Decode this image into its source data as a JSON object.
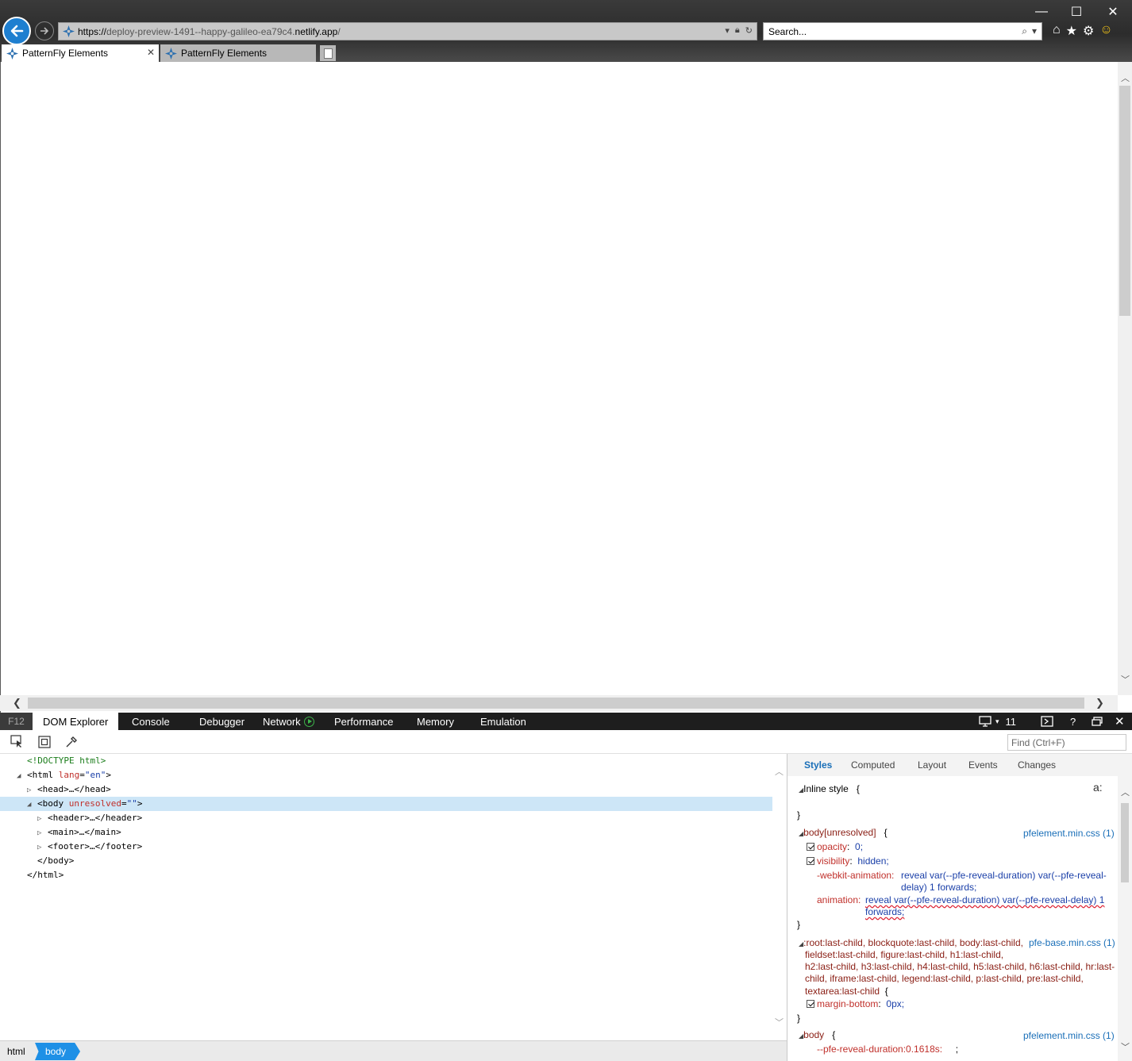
{
  "window": {
    "minimize": "—",
    "maximize": "☐",
    "close": "✕"
  },
  "address_bar": {
    "scheme": "https://",
    "host_prefix": "deploy-preview-1491--happy-galileo-ea79c4.",
    "host_domain": "netlify.app",
    "path": "/"
  },
  "search_bar": {
    "placeholder": "Search..."
  },
  "tabs": [
    {
      "label": "PatternFly Elements",
      "active": true
    },
    {
      "label": "PatternFly Elements",
      "active": false
    }
  ],
  "devtools": {
    "f12_label": "F12",
    "tabs": [
      "DOM Explorer",
      "Console",
      "Debugger",
      "Network",
      "Performance",
      "Memory",
      "Emulation"
    ],
    "doc_mode": "11",
    "help": "?",
    "find_placeholder": "Find (Ctrl+F)"
  },
  "dom_tree": {
    "doctype": "<!DOCTYPE html>",
    "html_open": "<html",
    "html_attr": "lang",
    "html_val": "\"en\"",
    "close_bracket": ">",
    "head": "<head>…</head>",
    "body_open": "<body",
    "body_attr": "unresolved",
    "body_val": "\"\"",
    "header": "<header>…</header>",
    "main": "<main>…</main>",
    "footer": "<footer>…</footer>",
    "body_close": "</body>",
    "html_close": "</html>"
  },
  "breadcrumb": [
    "html",
    "body"
  ],
  "styles_tabs": [
    "Styles",
    "Computed",
    "Layout",
    "Events",
    "Changes"
  ],
  "styles": {
    "inline_label": "Inline style",
    "open_brace": "{",
    "close_brace": "}",
    "font_toggle": "a:",
    "rule1": {
      "selector": "body[unresolved]",
      "source": "pfelement.min.css (1)",
      "p1": "opacity",
      "v1": "0;",
      "p2": "visibility",
      "v2": "hidden;",
      "p3": "-webkit-animation:",
      "v3a": "reveal var(--pfe-reveal-duration) var(--pfe-reveal-",
      "v3b": "delay) 1 forwards;",
      "p4": "animation:",
      "v4a": "reveal var(--pfe-reveal-duration) var(--pfe-reveal-delay) 1",
      "v4b": "forwards;"
    },
    "rule2": {
      "sel1": ":root:last-child, blockquote:last-child, body:last-child,",
      "sel2": "fieldset:last-child, figure:last-child, h1:last-child,",
      "sel3": "h2:last-child, h3:last-child, h4:last-child, h5:last-child, h6:last-child, hr:last-",
      "sel4": "child, iframe:last-child, legend:last-child, p:last-child, pre:last-child,",
      "sel5": "textarea:last-child",
      "source": "pfe-base.min.css (1)",
      "p1": "margin-bottom",
      "v1": "0px;"
    },
    "rule3": {
      "selector": "body",
      "source": "pfelement.min.css (1)",
      "p1": "--pfe-reveal-duration:0.1618s:",
      "v1": ";"
    }
  }
}
